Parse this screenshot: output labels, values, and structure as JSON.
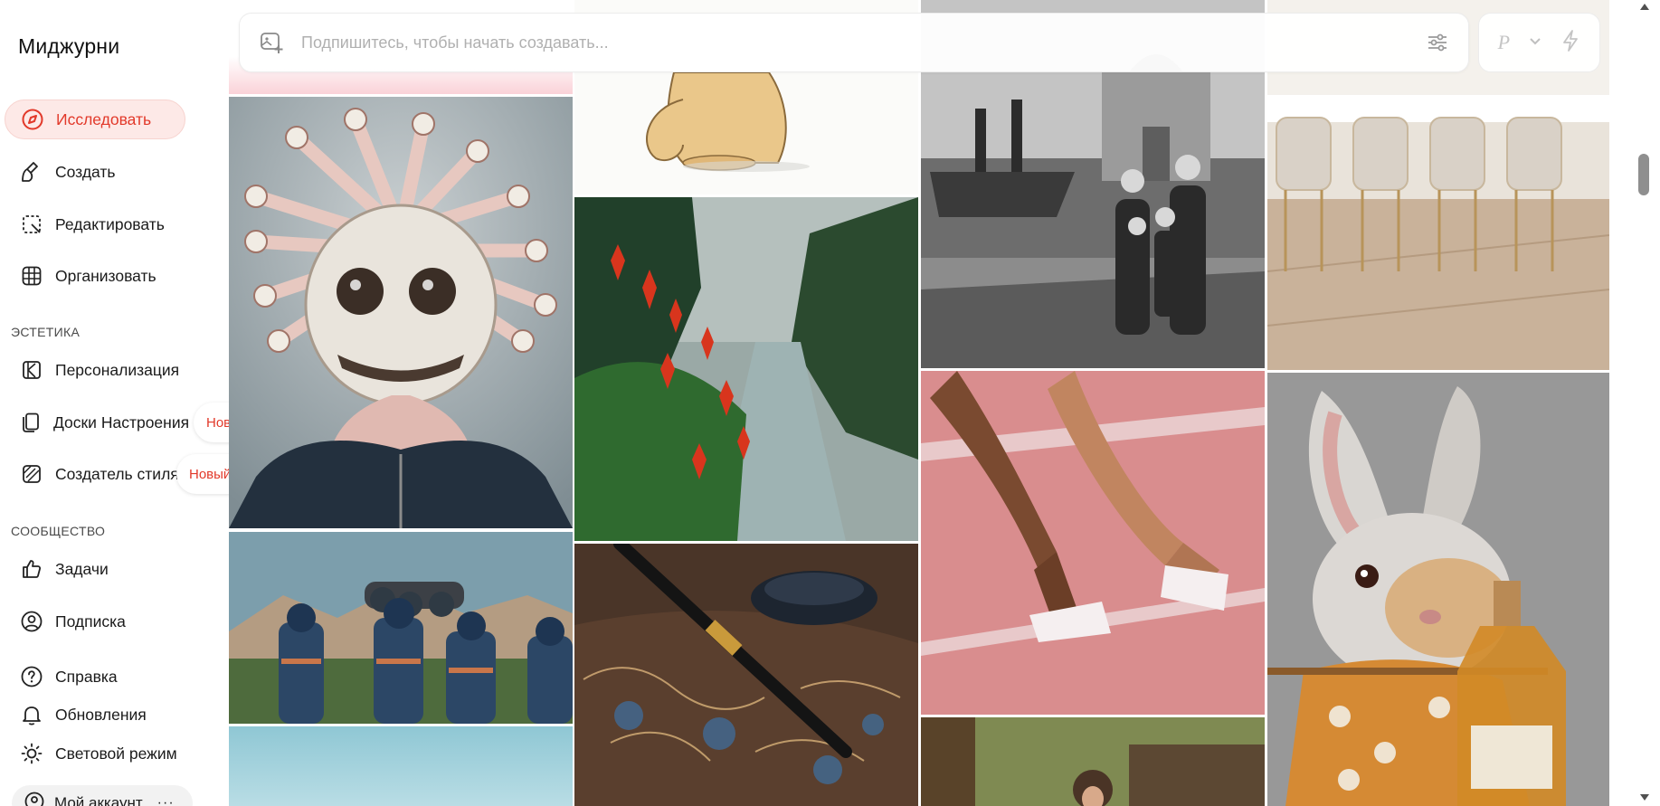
{
  "app": {
    "title": "Миджурни"
  },
  "nav": {
    "explore": "Исследовать",
    "create": "Создать",
    "edit": "Редактировать",
    "organize": "Организовать",
    "aesthetics_title": "ЭСТЕТИКА",
    "personalization": "Персонализация",
    "moodboards": "Доски Настроения",
    "style_creator": "Создатель стиля",
    "new_badge": "Новый!",
    "community_title": "СООБЩЕСТВО",
    "tasks": "Задачи",
    "subscription": "Подписка",
    "help": "Справка",
    "updates": "Обновления",
    "light_mode": "Световой режим",
    "account": "Мой аккаунт",
    "account_more": "···"
  },
  "prompt": {
    "placeholder": "Подпишитесь, чтобы начать создавать...",
    "tool_p": "P"
  },
  "colors": {
    "accent": "#e2392a",
    "active_bg": "#fde9e7"
  },
  "icons": {
    "explore": "compass-icon",
    "create": "brush-icon",
    "edit": "edit-icon",
    "organize": "grid-icon",
    "personalization": "personalize-icon",
    "moodboards": "moodboard-icon",
    "style_creator": "style-icon",
    "tasks": "thumbs-up-icon",
    "subscription": "user-circle-icon",
    "help": "help-icon",
    "updates": "bell-icon",
    "light_mode": "sun-icon"
  }
}
